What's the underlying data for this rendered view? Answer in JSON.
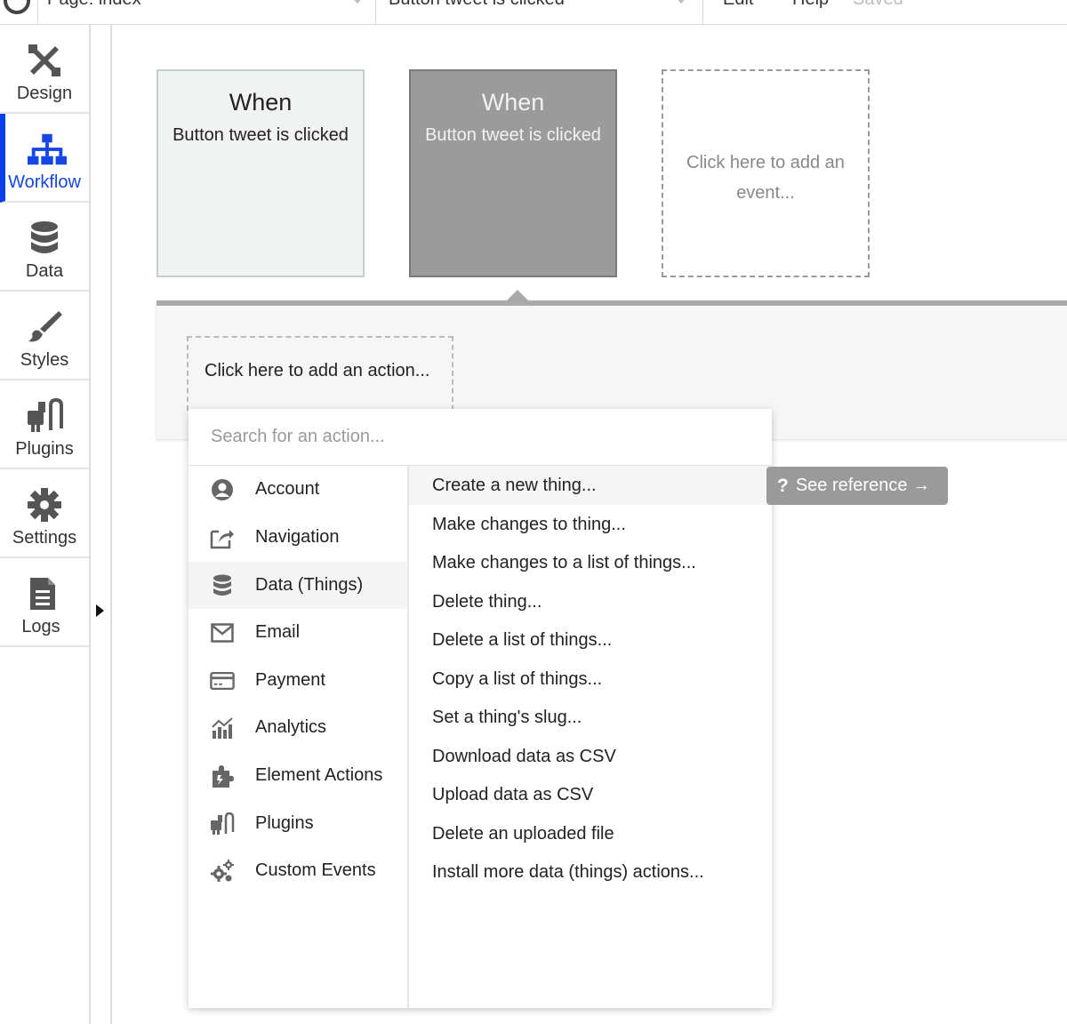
{
  "topbar": {
    "page_label": "Page: index",
    "event_label": "Button tweet is clicked",
    "menu_edit": "Edit",
    "menu_help": "Help",
    "status": "Saved"
  },
  "sidebar": {
    "items": [
      {
        "label": "Design",
        "icon": "design-icon"
      },
      {
        "label": "Workflow",
        "icon": "workflow-icon",
        "active": true
      },
      {
        "label": "Data",
        "icon": "database-icon"
      },
      {
        "label": "Styles",
        "icon": "brush-icon"
      },
      {
        "label": "Plugins",
        "icon": "plug-icon"
      },
      {
        "label": "Settings",
        "icon": "gear-icon"
      },
      {
        "label": "Logs",
        "icon": "document-icon"
      }
    ]
  },
  "events": [
    {
      "title": "When",
      "subtitle": "Button tweet is clicked"
    },
    {
      "title": "When",
      "subtitle": "Button tweet is clicked",
      "selected": true
    },
    {
      "title": "",
      "subtitle": "Click here to add an event..."
    }
  ],
  "panel": {
    "add_action": "Click here to add an action..."
  },
  "dropdown": {
    "search_placeholder": "Search for an action...",
    "categories": [
      {
        "label": "Account",
        "icon": "account-icon"
      },
      {
        "label": "Navigation",
        "icon": "navigation-icon"
      },
      {
        "label": "Data (Things)",
        "icon": "database-icon",
        "active": true
      },
      {
        "label": "Email",
        "icon": "email-icon"
      },
      {
        "label": "Payment",
        "icon": "credit-card-icon"
      },
      {
        "label": "Analytics",
        "icon": "analytics-icon"
      },
      {
        "label": "Element Actions",
        "icon": "puzzle-icon"
      },
      {
        "label": "Plugins",
        "icon": "plug-icon"
      },
      {
        "label": "Custom Events",
        "icon": "gears-icon"
      }
    ],
    "actions": [
      "Create a new thing...",
      "Make changes to thing...",
      "Make changes to a list of things...",
      "Delete thing...",
      "Delete a list of things...",
      "Copy a list of things...",
      "Set a thing's slug...",
      "Download data as CSV",
      "Upload data as CSV",
      "Delete an uploaded file",
      "Install more data (things) actions..."
    ],
    "see_reference": "See reference →",
    "see_reference_glyph": "?"
  },
  "colors": {
    "accent": "#1646e6",
    "selected_card": "#9b9b9b",
    "panel_bar": "#aaaaaa"
  }
}
